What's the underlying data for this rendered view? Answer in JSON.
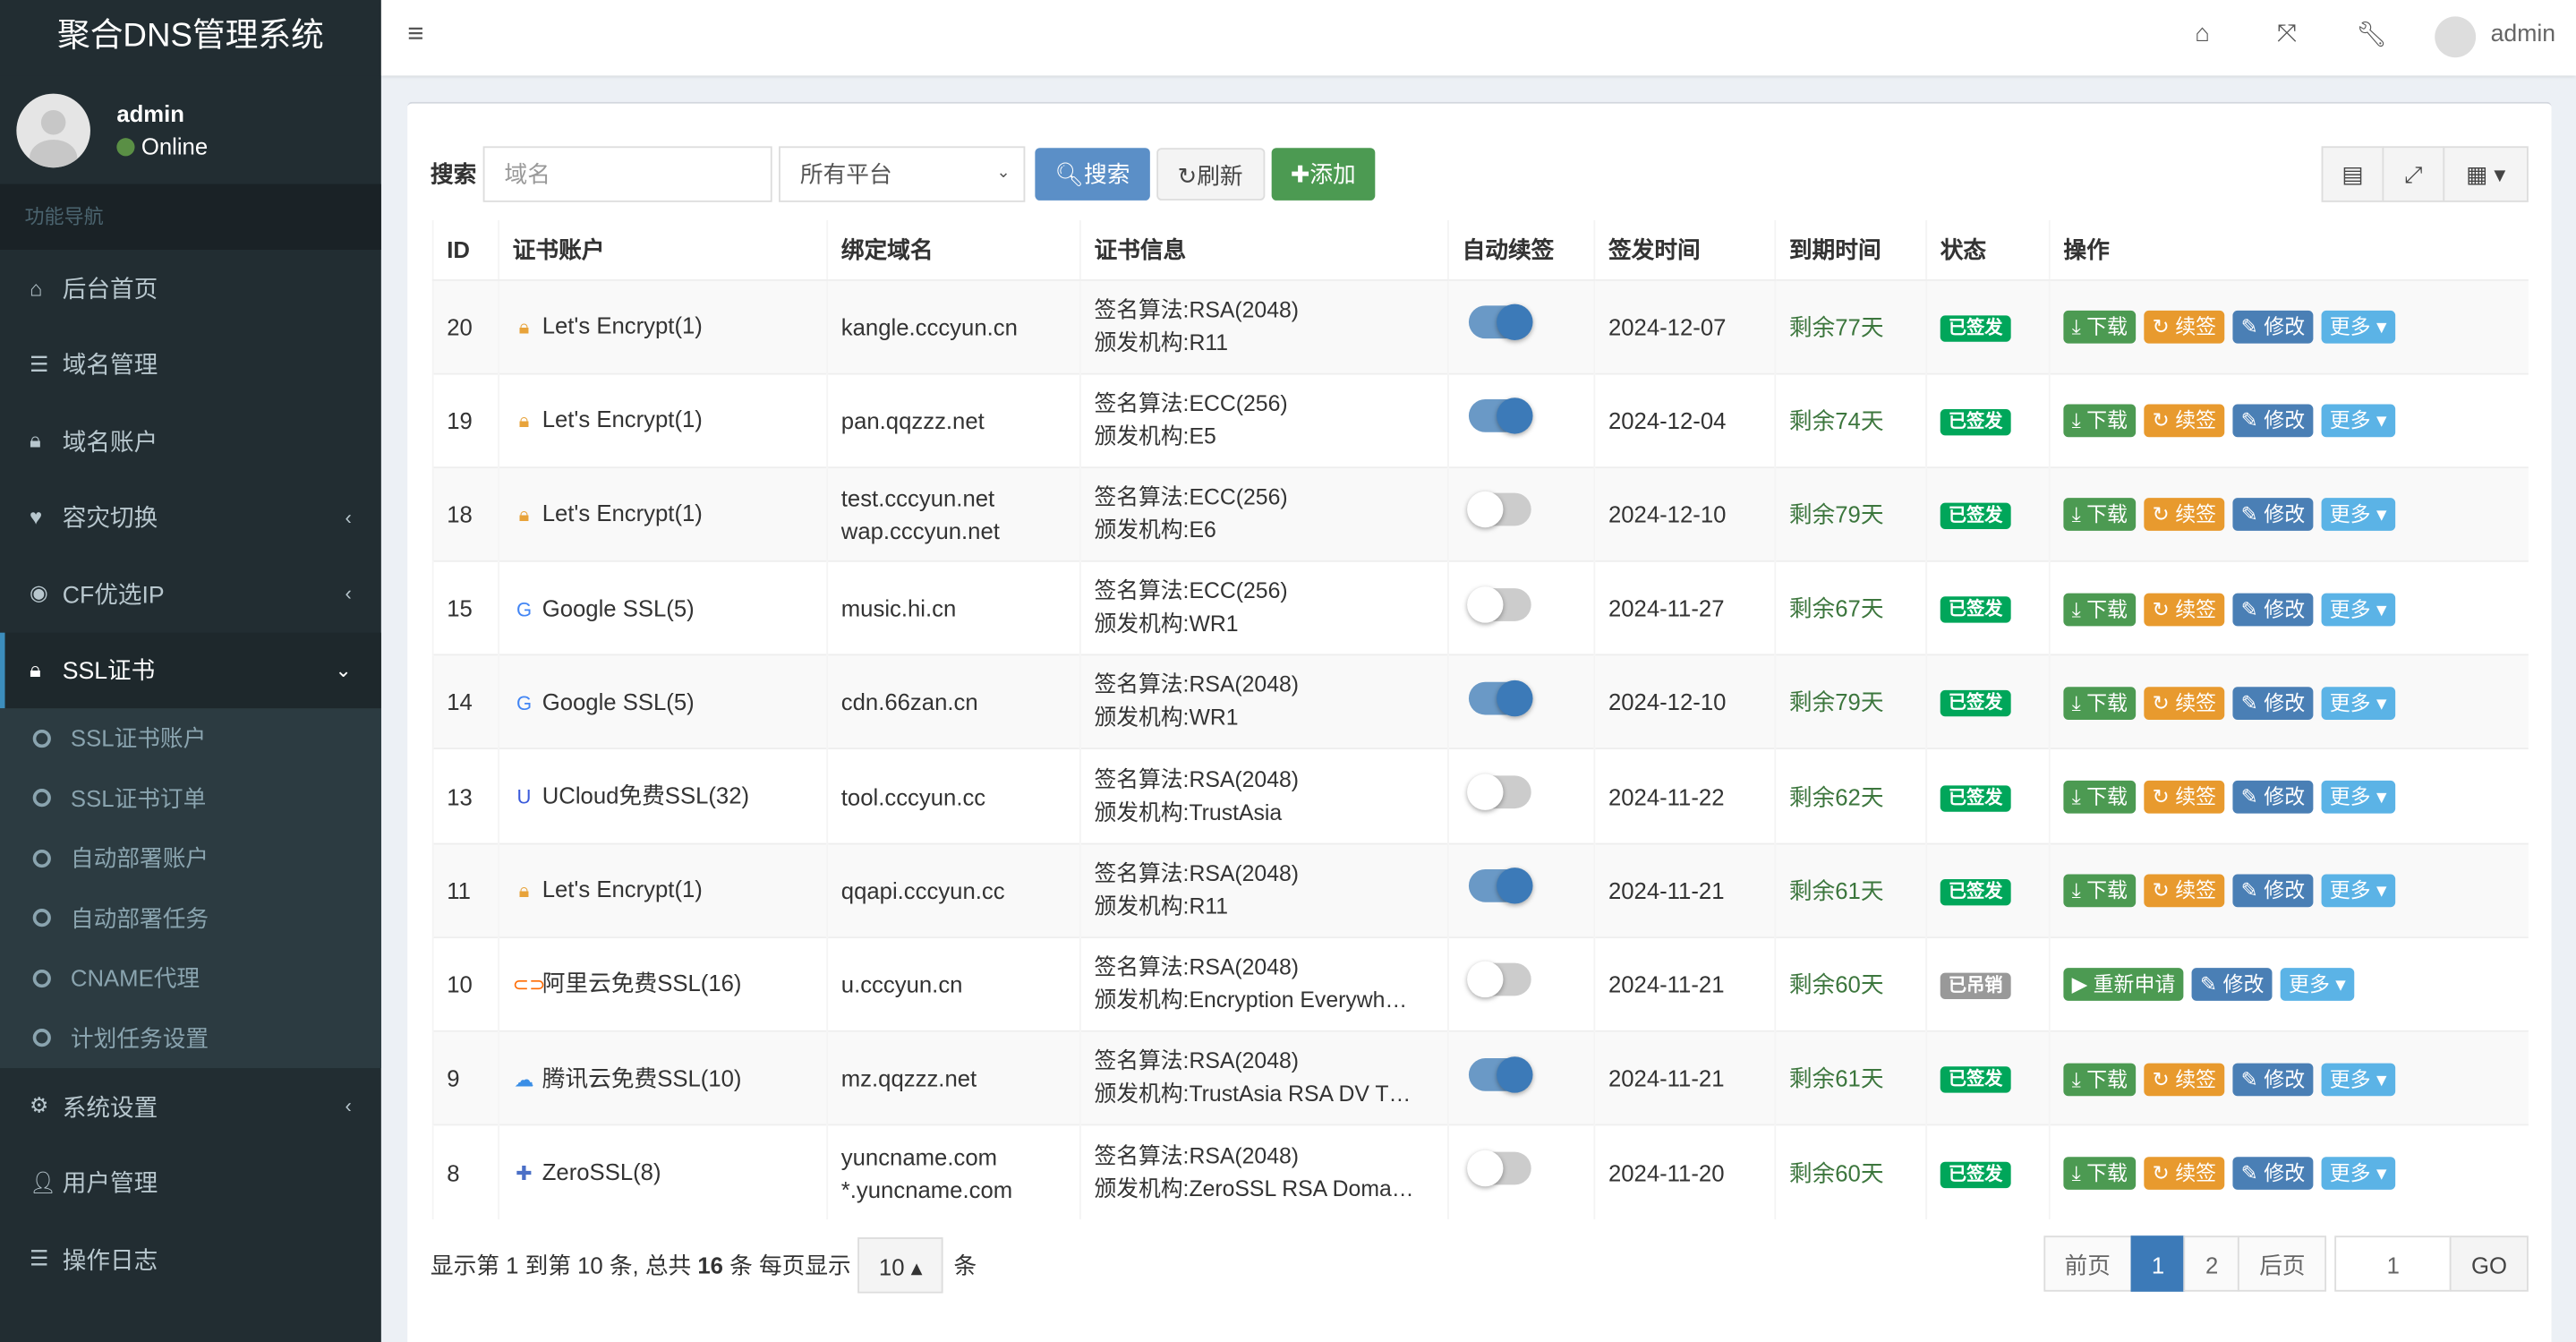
{
  "app": {
    "title": "聚合DNS管理系统"
  },
  "user": {
    "name": "admin",
    "status": "Online"
  },
  "sidebar": {
    "header": "功能导航",
    "items": [
      {
        "label": "后台首页",
        "icon": "home-icon"
      },
      {
        "label": "域名管理",
        "icon": "list-icon"
      },
      {
        "label": "域名账户",
        "icon": "lock-icon"
      },
      {
        "label": "容灾切换",
        "icon": "heartbeat-icon",
        "chevron": "‹"
      },
      {
        "label": "CF优选IP",
        "icon": "globe-icon",
        "chevron": "‹"
      },
      {
        "label": "SSL证书",
        "icon": "lock-circle-icon",
        "chevron": "⌄",
        "active": true
      },
      {
        "label": "系统设置",
        "icon": "gears-icon",
        "chevron": "‹"
      },
      {
        "label": "用户管理",
        "icon": "user-icon"
      },
      {
        "label": "操作日志",
        "icon": "list-icon"
      }
    ],
    "subitems": [
      "SSL证书账户",
      "SSL证书订单",
      "自动部署账户",
      "自动部署任务",
      "CNAME代理",
      "计划任务设置"
    ]
  },
  "topbar": {
    "user": "admin"
  },
  "toolbar": {
    "search_label": "搜索",
    "domain_placeholder": "域名",
    "platform": "所有平台",
    "search_btn": "搜索",
    "refresh_btn": "刷新",
    "add_btn": "添加"
  },
  "table": {
    "headers": [
      "ID",
      "证书账户",
      "绑定域名",
      "证书信息",
      "自动续签",
      "签发时间",
      "到期时间",
      "状态",
      "操作"
    ],
    "rows": [
      {
        "id": "20",
        "account": "Let's Encrypt(1)",
        "icon": "letsencrypt-icon",
        "domains": [
          "kangle.cccyun.cn"
        ],
        "algo": "签名算法:RSA(2048)",
        "issuer": "颁发机构:R11",
        "auto": true,
        "sign": "2024-12-07",
        "remain": "剩余77天",
        "status": "已签发"
      },
      {
        "id": "19",
        "account": "Let's Encrypt(1)",
        "icon": "letsencrypt-icon",
        "domains": [
          "pan.qqzzz.net"
        ],
        "algo": "签名算法:ECC(256)",
        "issuer": "颁发机构:E5",
        "auto": true,
        "sign": "2024-12-04",
        "remain": "剩余74天",
        "status": "已签发"
      },
      {
        "id": "18",
        "account": "Let's Encrypt(1)",
        "icon": "letsencrypt-icon",
        "domains": [
          "test.cccyun.net",
          "wap.cccyun.net"
        ],
        "algo": "签名算法:ECC(256)",
        "issuer": "颁发机构:E6",
        "auto": false,
        "sign": "2024-12-10",
        "remain": "剩余79天",
        "status": "已签发"
      },
      {
        "id": "15",
        "account": "Google SSL(5)",
        "icon": "google-icon",
        "domains": [
          "music.hi.cn"
        ],
        "algo": "签名算法:ECC(256)",
        "issuer": "颁发机构:WR1",
        "auto": false,
        "sign": "2024-11-27",
        "remain": "剩余67天",
        "status": "已签发"
      },
      {
        "id": "14",
        "account": "Google SSL(5)",
        "icon": "google-icon",
        "domains": [
          "cdn.66zan.cn"
        ],
        "algo": "签名算法:RSA(2048)",
        "issuer": "颁发机构:WR1",
        "auto": true,
        "sign": "2024-12-10",
        "remain": "剩余79天",
        "status": "已签发"
      },
      {
        "id": "13",
        "account": "UCloud免费SSL(32)",
        "icon": "ucloud-icon",
        "domains": [
          "tool.cccyun.cc"
        ],
        "algo": "签名算法:RSA(2048)",
        "issuer": "颁发机构:TrustAsia",
        "auto": false,
        "sign": "2024-11-22",
        "remain": "剩余62天",
        "status": "已签发"
      },
      {
        "id": "11",
        "account": "Let's Encrypt(1)",
        "icon": "letsencrypt-icon",
        "domains": [
          "qqapi.cccyun.cc"
        ],
        "algo": "签名算法:RSA(2048)",
        "issuer": "颁发机构:R11",
        "auto": true,
        "sign": "2024-11-21",
        "remain": "剩余61天",
        "status": "已签发"
      },
      {
        "id": "10",
        "account": "阿里云免费SSL(16)",
        "icon": "aliyun-icon",
        "domains": [
          "u.cccyun.cn"
        ],
        "algo": "签名算法:RSA(2048)",
        "issuer": "颁发机构:Encryption Everywh…",
        "auto": false,
        "sign": "2024-11-21",
        "remain": "剩余60天",
        "status": "已吊销",
        "revoked": true
      },
      {
        "id": "9",
        "account": "腾讯云免费SSL(10)",
        "icon": "tencent-cloud-icon",
        "domains": [
          "mz.qqzzz.net"
        ],
        "algo": "签名算法:RSA(2048)",
        "issuer": "颁发机构:TrustAsia RSA DV T…",
        "auto": true,
        "sign": "2024-11-21",
        "remain": "剩余61天",
        "status": "已签发"
      },
      {
        "id": "8",
        "account": "ZeroSSL(8)",
        "icon": "zerossl-icon",
        "domains": [
          "yuncname.com",
          "*.yuncname.com"
        ],
        "algo": "签名算法:RSA(2048)",
        "issuer": "颁发机构:ZeroSSL RSA Doma…",
        "auto": false,
        "sign": "2024-11-20",
        "remain": "剩余60天",
        "status": "已签发"
      }
    ]
  },
  "actions": {
    "download": "下载",
    "renew": "续签",
    "edit": "修改",
    "more": "更多",
    "reapply": "重新申请"
  },
  "footer": {
    "p1": "显示第 ",
    "from": "1",
    "p2": " 到第 ",
    "to": "10",
    "p3": " 条, 总共 ",
    "total": "16",
    "p4": " 条  每页显示",
    "page_size": "10",
    "p5": "条"
  },
  "pager": {
    "prev": "前页",
    "pages": [
      "1",
      "2"
    ],
    "next": "后页",
    "jump_value": "1",
    "go": "GO",
    "current": "1"
  },
  "colors": {
    "sidebar": "#222d32",
    "primary": "#3c7ab8",
    "success": "#4c9a52",
    "warning": "#e89a2e",
    "info": "#5bb3e6"
  }
}
